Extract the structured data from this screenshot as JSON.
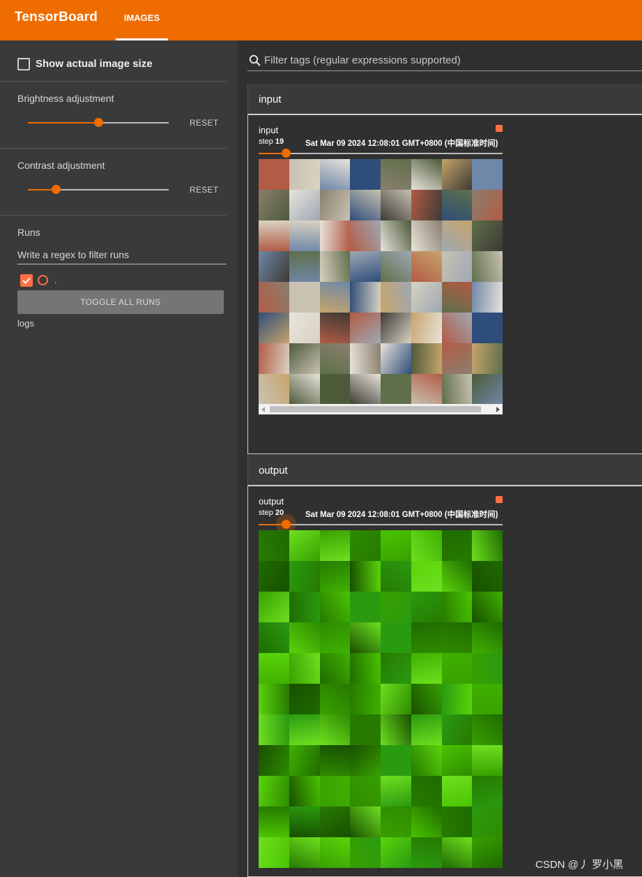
{
  "header": {
    "brand": "TensorBoard",
    "tabs": [
      {
        "label": "IMAGES"
      }
    ]
  },
  "sidebar": {
    "show_actual_size_label": "Show actual image size",
    "brightness": {
      "title": "Brightness adjustment",
      "value": 0.5,
      "reset_label": "RESET"
    },
    "contrast": {
      "title": "Contrast adjustment",
      "value": 0.2,
      "reset_label": "RESET"
    },
    "runs": {
      "title": "Runs",
      "filter_placeholder": "Write a regex to filter runs",
      "items": [
        {
          "name": "."
        }
      ],
      "toggle_all_label": "TOGGLE ALL RUNS",
      "logs_label": "logs"
    }
  },
  "main": {
    "filter_placeholder": "Filter tags (regular expressions supported)",
    "groups": [
      {
        "header": "input",
        "card": {
          "title": "input",
          "step_prefix": "step",
          "step": "19",
          "time": "Sat Mar 09 2024 12:08:01 GMT+0800 (中国标准时间)",
          "step_fraction": 0.11
        }
      },
      {
        "header": "output",
        "card": {
          "title": "output",
          "step_prefix": "step",
          "step": "20",
          "time": "Sat Mar 09 2024 12:08:01 GMT+0800 (中国标准时间)",
          "step_fraction": 0.11
        }
      }
    ]
  },
  "colors": {
    "accent": "#ef6c00",
    "run_color": "#ff7043",
    "background": "#303030",
    "sidebar": "#3a3a3a"
  },
  "watermark": "CSDN @丿 罗小黑"
}
